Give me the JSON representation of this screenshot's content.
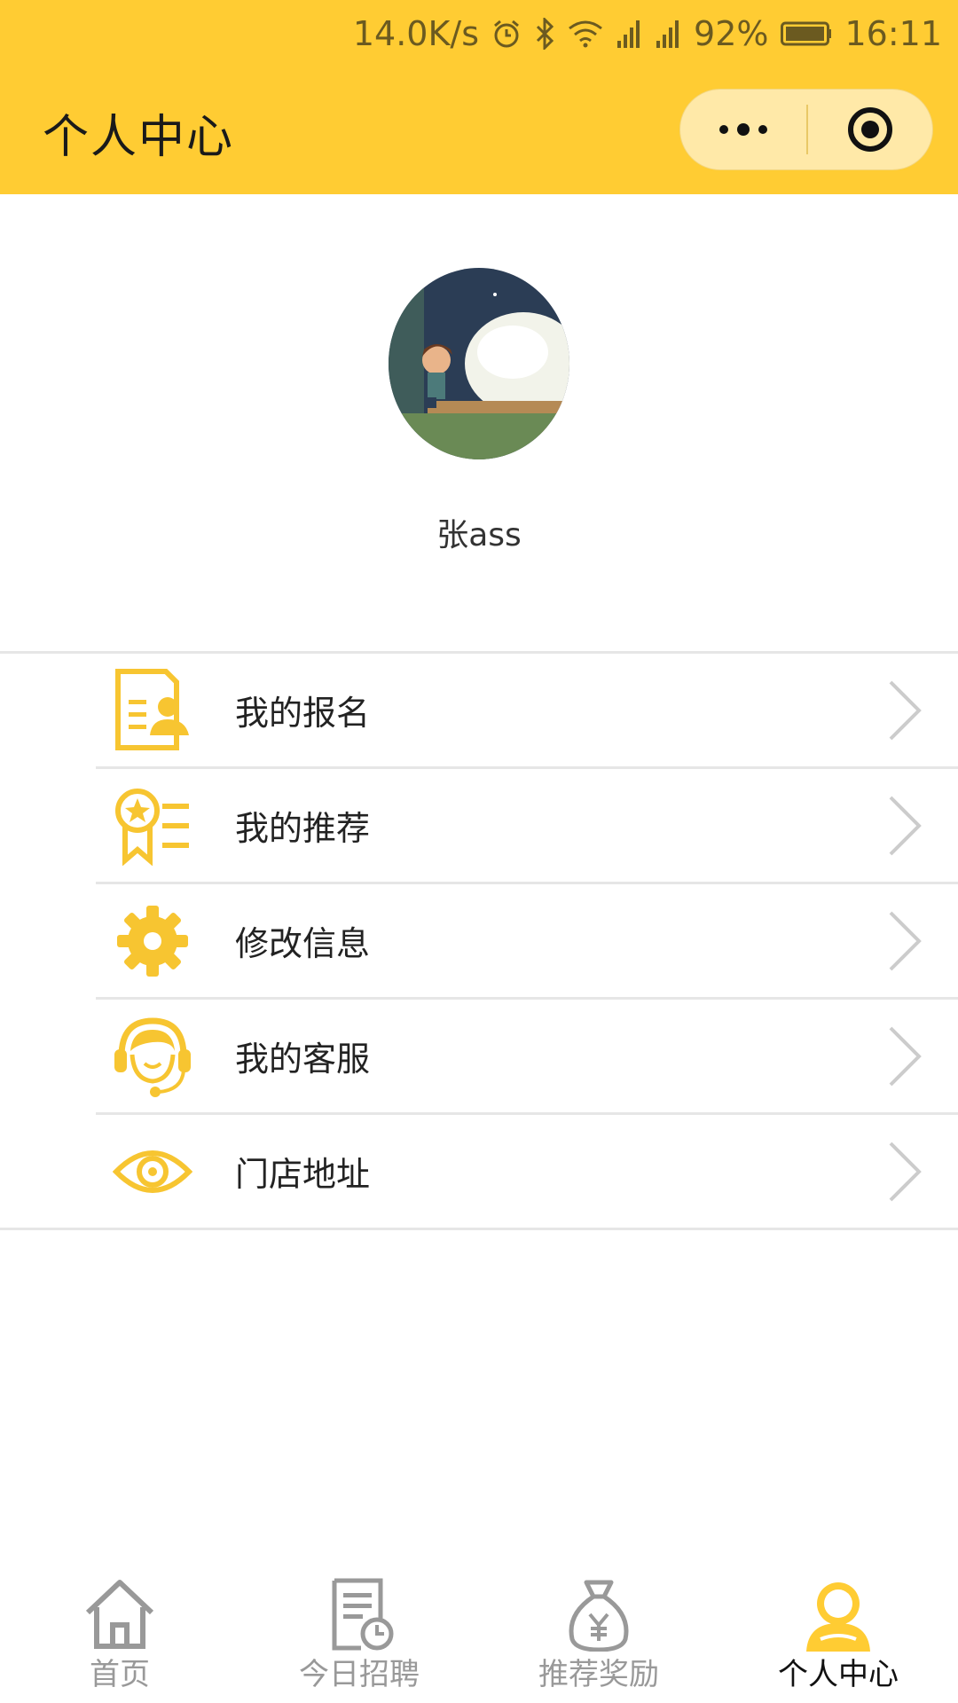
{
  "status_bar": {
    "speed": "14.0K/s",
    "battery_pct": "92%",
    "time": "16:11",
    "icons": [
      "alarm-icon",
      "bluetooth-icon",
      "wifi-icon",
      "signal-icon",
      "signal-icon",
      "battery-icon"
    ]
  },
  "header": {
    "title": "个人中心",
    "more_icon": "more-dots-icon",
    "close_icon": "target-close-icon"
  },
  "profile": {
    "username": "张ass",
    "avatar_icon": "avatar-image"
  },
  "menu": {
    "items": [
      {
        "label": "我的报名",
        "icon": "resume-icon"
      },
      {
        "label": "我的推荐",
        "icon": "award-list-icon"
      },
      {
        "label": "修改信息",
        "icon": "gear-icon"
      },
      {
        "label": "我的客服",
        "icon": "customer-service-icon"
      },
      {
        "label": "门店地址",
        "icon": "eye-icon"
      }
    ],
    "arrow_icon": "chevron-right-icon"
  },
  "tabbar": {
    "tabs": [
      {
        "label": "首页",
        "icon": "home-icon",
        "active": false
      },
      {
        "label": "今日招聘",
        "icon": "document-clock-icon",
        "active": false
      },
      {
        "label": "推荐奖励",
        "icon": "money-bag-icon",
        "active": false
      },
      {
        "label": "个人中心",
        "icon": "user-icon",
        "active": true
      }
    ]
  },
  "colors": {
    "brand_yellow": "#ffcc33",
    "icon_yellow": "#f7c531",
    "divider": "#e6e6e6",
    "tab_inactive": "#999999",
    "tab_active": "#111111"
  }
}
